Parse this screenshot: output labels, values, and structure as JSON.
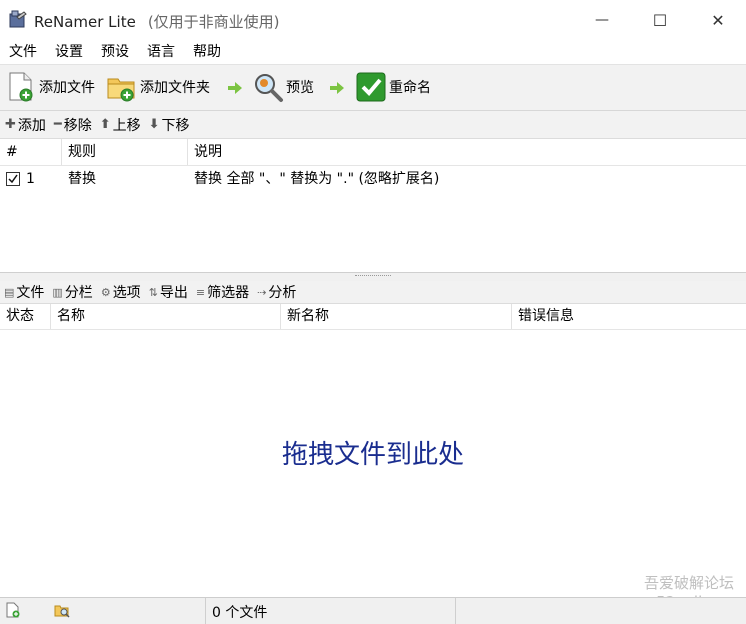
{
  "window": {
    "title": "ReNamer Lite",
    "subtitle": "(仅用于非商业使用)",
    "minimize_glyph": "—",
    "maximize_glyph": "☐",
    "close_glyph": "✕"
  },
  "menu": [
    "文件",
    "设置",
    "预设",
    "语言",
    "帮助"
  ],
  "toolbar": {
    "add_files": "添加文件",
    "add_folder": "添加文件夹",
    "preview": "预览",
    "rename": "重命名"
  },
  "rules_toolbar": {
    "add": "添加",
    "remove": "移除",
    "move_up": "上移",
    "move_down": "下移"
  },
  "rules_table": {
    "columns": [
      "#",
      "规则",
      "说明"
    ],
    "rows": [
      {
        "checked": true,
        "index": "1",
        "rule": "替换",
        "description": "替换 全部 \"、\" 替换为 \".\" (忽略扩展名)"
      }
    ]
  },
  "files_toolbar": {
    "files": "文件",
    "columns": "分栏",
    "options": "选项",
    "export": "导出",
    "filters": "筛选器",
    "analyze": "分析"
  },
  "files_table": {
    "columns": [
      "状态",
      "名称",
      "新名称",
      "错误信息"
    ],
    "drop_hint": "拖拽文件到此处"
  },
  "watermark": {
    "line1": "吾爱破解论坛",
    "line2": "www.52pojie.cn"
  },
  "statusbar": {
    "file_count": "0 个文件"
  },
  "colors": {
    "drop_hint": "#1a2d8f",
    "toolbar_bg": "#f2f2f2",
    "accent_green": "#3aa335"
  }
}
